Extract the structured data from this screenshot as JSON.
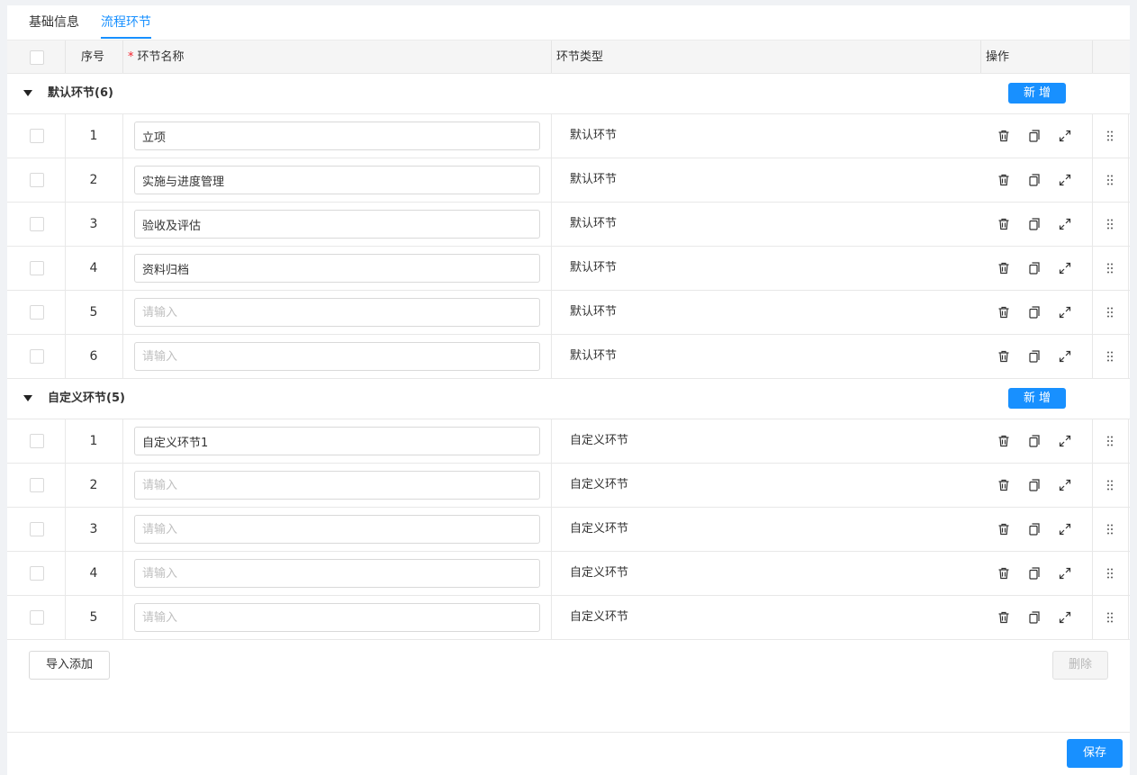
{
  "tabs": [
    {
      "label": "基础信息",
      "active": false
    },
    {
      "label": "流程环节",
      "active": true
    }
  ],
  "table": {
    "headers": {
      "index": "序号",
      "required_mark": "*",
      "name": "环节名称",
      "type": "环节类型",
      "actions": "操作"
    },
    "input_placeholder": "请输入",
    "groups": [
      {
        "title": "默认环节(6)",
        "add_label": "新增",
        "rows": [
          {
            "index": "1",
            "name": "立项",
            "type": "默认环节"
          },
          {
            "index": "2",
            "name": "实施与进度管理",
            "type": "默认环节"
          },
          {
            "index": "3",
            "name": "验收及评估",
            "type": "默认环节"
          },
          {
            "index": "4",
            "name": "资料归档",
            "type": "默认环节"
          },
          {
            "index": "5",
            "name": "",
            "type": "默认环节"
          },
          {
            "index": "6",
            "name": "",
            "type": "默认环节"
          }
        ]
      },
      {
        "title": "自定义环节(5)",
        "add_label": "新增",
        "rows": [
          {
            "index": "1",
            "name": "自定义环节1",
            "type": "自定义环节"
          },
          {
            "index": "2",
            "name": "",
            "type": "自定义环节"
          },
          {
            "index": "3",
            "name": "",
            "type": "自定义环节"
          },
          {
            "index": "4",
            "name": "",
            "type": "自定义环节"
          },
          {
            "index": "5",
            "name": "",
            "type": "自定义环节"
          }
        ]
      }
    ],
    "row_icons": [
      "trash-icon",
      "copy-icon",
      "expand-icon",
      "drag-handle-icon"
    ]
  },
  "footer": {
    "import_label": "导入添加",
    "delete_label": "删除",
    "save_label": "保存"
  },
  "colors": {
    "primary": "#1890ff",
    "required": "#f5222d"
  }
}
